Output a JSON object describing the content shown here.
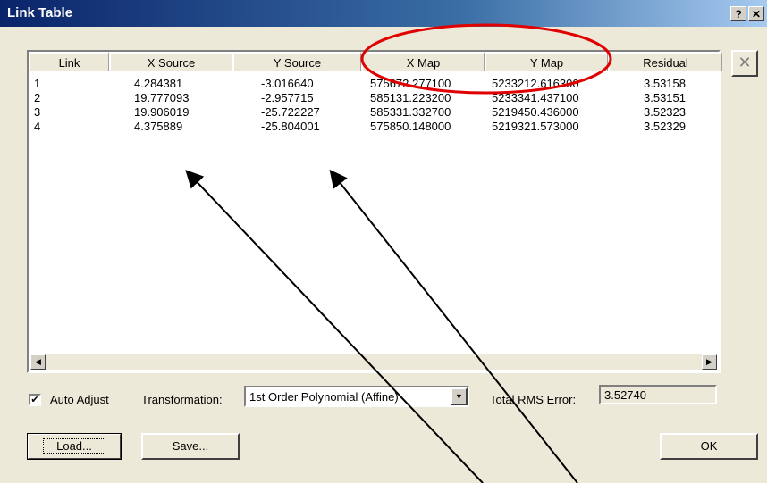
{
  "window": {
    "title": "Link Table",
    "help_label": "?",
    "close_label": "✕"
  },
  "delete_label": "✕",
  "table": {
    "columns": [
      "Link",
      "X Source",
      "Y Source",
      "X Map",
      "Y Map",
      "Residual"
    ],
    "rows": [
      [
        "1",
        "4.284381",
        "-3.016640",
        "575672.277100",
        "5233212.616300",
        "3.53158"
      ],
      [
        "2",
        "19.777093",
        "-2.957715",
        "585131.223200",
        "5233341.437100",
        "3.53151"
      ],
      [
        "3",
        "19.906019",
        "-25.722227",
        "585331.332700",
        "5219450.436000",
        "3.52323"
      ],
      [
        "4",
        "4.375889",
        "-25.804001",
        "575850.148000",
        "5219321.573000",
        "3.52329"
      ]
    ]
  },
  "scroll_left": "◀",
  "scroll_right": "▶",
  "auto_adjust": {
    "label": "Auto Adjust",
    "checked": true,
    "mark": "✔"
  },
  "transformation": {
    "label": "Transformation:",
    "value": "1st Order Polynomial (Affine)",
    "arrow": "▼"
  },
  "rms": {
    "label": "Total RMS Error:",
    "value": "3.52740"
  },
  "buttons": {
    "load": "Load...",
    "save": "Save...",
    "ok": "OK"
  },
  "annotation_color": "#e00000"
}
